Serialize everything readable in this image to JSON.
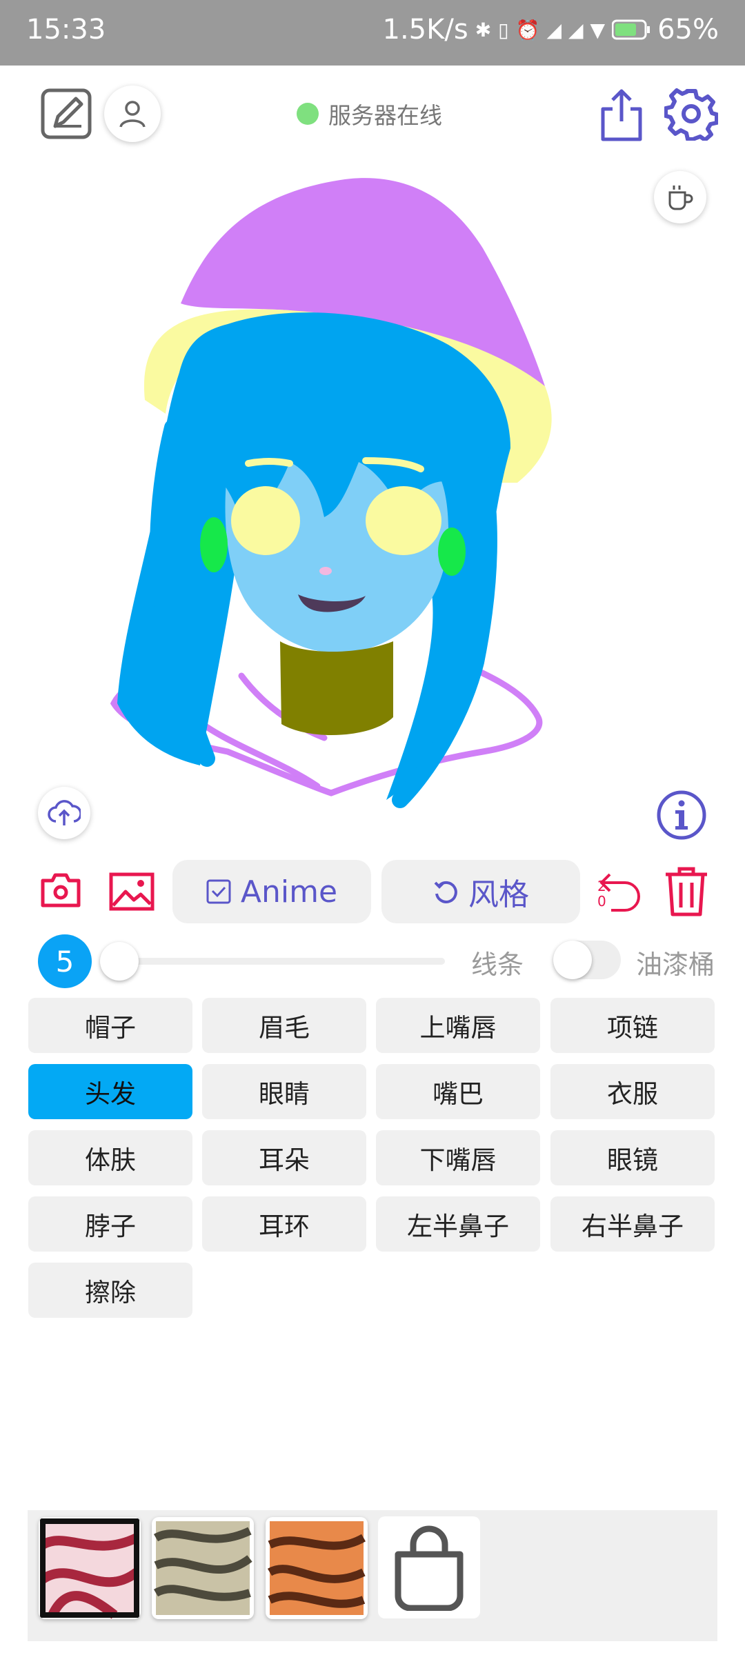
{
  "status": {
    "time": "15:33",
    "speed": "1.5K/s",
    "battery": "65%"
  },
  "server": {
    "label": "服务器在线",
    "color": "#7fe07f"
  },
  "toolbar": {
    "anime_label": "Anime",
    "style_label": "风格",
    "undo_count": "20"
  },
  "brush": {
    "size": "5",
    "line_label": "线条",
    "bucket_label": "油漆桶",
    "bucket_on": false
  },
  "parts": [
    {
      "label": "帽子"
    },
    {
      "label": "眉毛"
    },
    {
      "label": "上嘴唇"
    },
    {
      "label": "项链"
    },
    {
      "label": "头发"
    },
    {
      "label": "眼睛"
    },
    {
      "label": "嘴巴"
    },
    {
      "label": "衣服"
    },
    {
      "label": "体肤"
    },
    {
      "label": "耳朵"
    },
    {
      "label": "下嘴唇"
    },
    {
      "label": "眼镜"
    },
    {
      "label": "脖子"
    },
    {
      "label": "耳环"
    },
    {
      "label": "左半鼻子"
    },
    {
      "label": "右半鼻子"
    },
    {
      "label": "擦除"
    }
  ],
  "selected_part": "头发",
  "colors": {
    "accent": "#5a56c9",
    "red": "#e8174f",
    "selected": "#03a9f4",
    "hat": "#d07ff7",
    "hat_brim": "#fafaa0",
    "hair": "#00a4f0",
    "skin": "#7fcff7",
    "neck": "#808000",
    "eye": "#fafaa0",
    "ear": "#16e84a",
    "clothes": "#d07ff7"
  },
  "icons": [
    "edit-icon",
    "user-icon",
    "share-icon",
    "gear-icon",
    "coffee-icon",
    "cloud-upload-icon",
    "info-icon",
    "camera-icon",
    "image-icon",
    "checkbox-icon",
    "undo-style-icon",
    "undo-icon",
    "trash-icon",
    "shopping-bag-icon"
  ]
}
